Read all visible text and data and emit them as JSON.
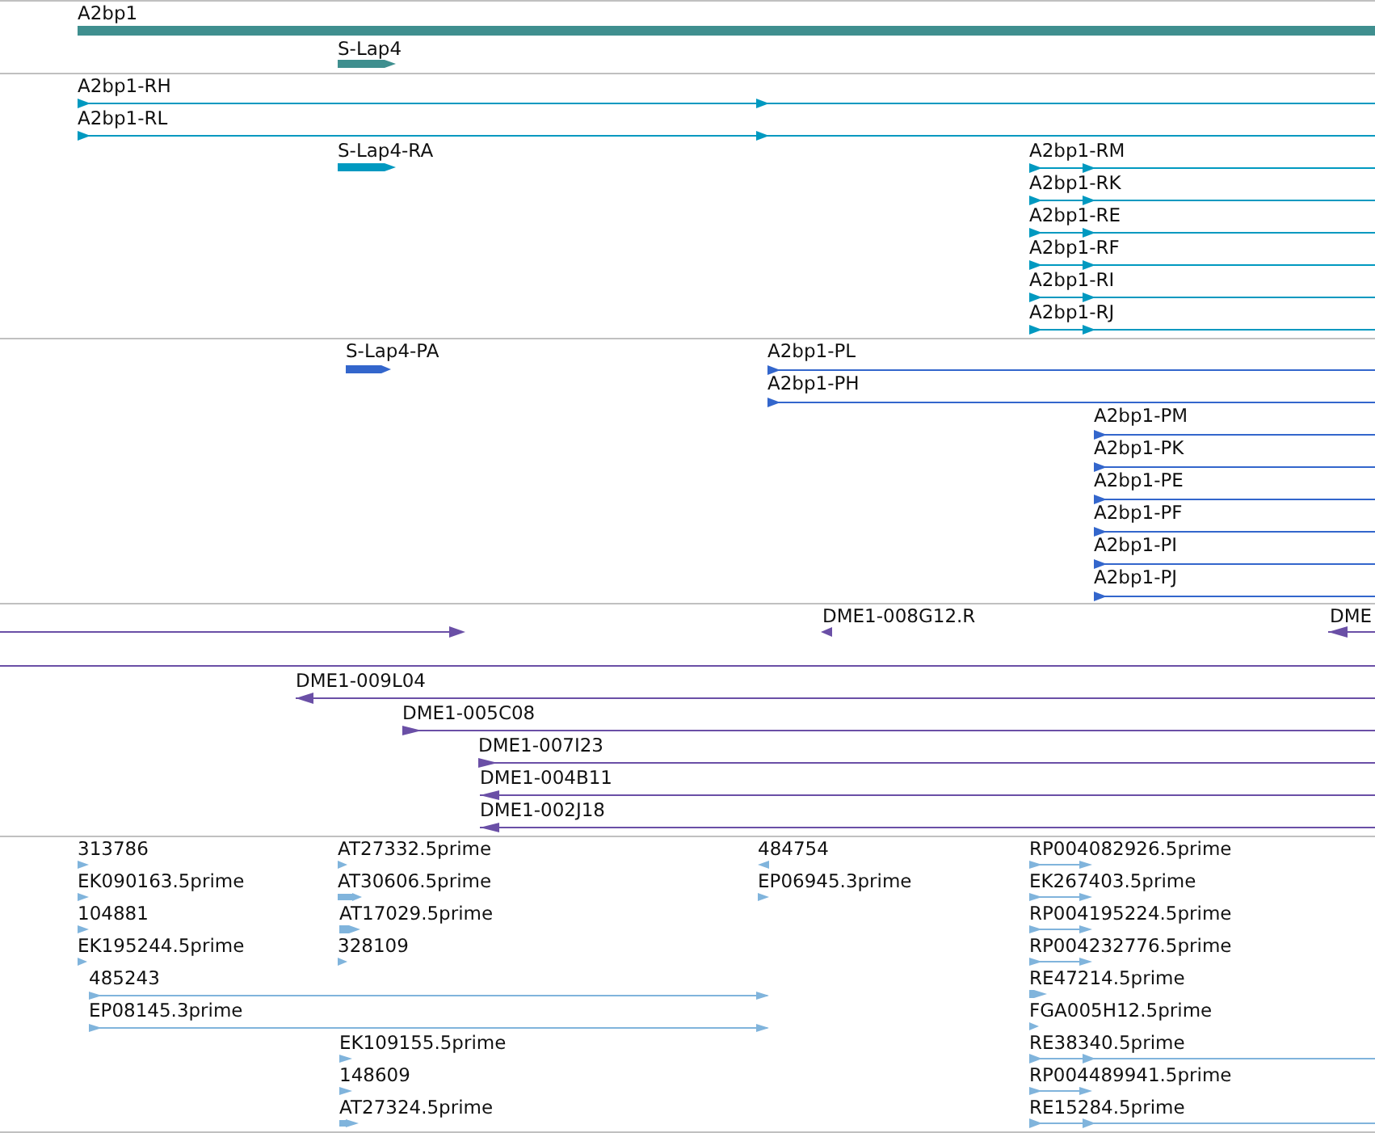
{
  "tracks": [
    {
      "color": "#3f8f8f",
      "features": [
        {
          "label": "A2bp1",
          "kind": "plain"
        },
        {
          "label": "S-Lap4",
          "kind": "arrow",
          "reverse": false
        }
      ]
    },
    {
      "color": "#0099c0",
      "features": [
        {
          "label": "A2bp1-RH",
          "kind": "arrow",
          "reverse": false
        },
        {
          "label": "A2bp1-RL",
          "kind": "arrow",
          "reverse": false
        },
        {
          "label": "S-Lap4-RA",
          "kind": "arrow",
          "reverse": false
        },
        {
          "label": "A2bp1-RM",
          "kind": "arrow",
          "reverse": false
        },
        {
          "label": "A2bp1-RK",
          "kind": "arrow",
          "reverse": false
        },
        {
          "label": "A2bp1-RE",
          "kind": "arrow",
          "reverse": false
        },
        {
          "label": "A2bp1-RF",
          "kind": "arrow",
          "reverse": false
        },
        {
          "label": "A2bp1-RI",
          "kind": "arrow",
          "reverse": false
        },
        {
          "label": "A2bp1-RJ",
          "kind": "arrow",
          "reverse": false
        }
      ]
    },
    {
      "color": "#3366cc",
      "features": [
        {
          "label": "S-Lap4-PA",
          "kind": "arrow",
          "reverse": false
        },
        {
          "label": "A2bp1-PL",
          "kind": "arrow",
          "reverse": false
        },
        {
          "label": "A2bp1-PH",
          "kind": "arrow",
          "reverse": false
        },
        {
          "label": "A2bp1-PM",
          "kind": "arrow",
          "reverse": false
        },
        {
          "label": "A2bp1-PK",
          "kind": "arrow",
          "reverse": false
        },
        {
          "label": "A2bp1-PE",
          "kind": "arrow",
          "reverse": false
        },
        {
          "label": "A2bp1-PF",
          "kind": "arrow",
          "reverse": false
        },
        {
          "label": "A2bp1-PI",
          "kind": "arrow",
          "reverse": false
        },
        {
          "label": "A2bp1-PJ",
          "kind": "arrow",
          "reverse": false
        }
      ]
    },
    {
      "color": "#6a4fa6",
      "features": [
        {
          "kind": "arrow",
          "reverse": false
        },
        {
          "label": "DME1-008G12.R",
          "kind": "arrow",
          "reverse": true
        },
        {
          "label": "DME",
          "kind": "arrow",
          "reverse": true
        },
        {
          "kind": "plain"
        },
        {
          "label": "DME1-009L04",
          "kind": "arrow",
          "reverse": true
        },
        {
          "label": "DME1-005C08",
          "kind": "arrow",
          "reverse": false
        },
        {
          "label": "DME1-007I23",
          "kind": "arrow",
          "reverse": false
        },
        {
          "label": "DME1-004B11",
          "kind": "arrow",
          "reverse": true
        },
        {
          "label": "DME1-002J18",
          "kind": "arrow",
          "reverse": true
        }
      ]
    },
    {
      "color": "#80b4dc",
      "features": [
        {
          "label": "313786",
          "kind": "arrow",
          "reverse": false
        },
        {
          "label": "EK090163.5prime",
          "kind": "arrow",
          "reverse": false
        },
        {
          "label": "104881",
          "kind": "arrow",
          "reverse": false
        },
        {
          "label": "EK195244.5prime",
          "kind": "arrow",
          "reverse": false
        },
        {
          "label": "485243",
          "kind": "arrow",
          "reverse": false
        },
        {
          "label": "EP08145.3prime",
          "kind": "arrow",
          "reverse": false
        },
        {
          "label": "AT27332.5prime",
          "kind": "arrow",
          "reverse": false
        },
        {
          "label": "AT30606.5prime",
          "kind": "arrow",
          "reverse": false
        },
        {
          "label": "AT17029.5prime",
          "kind": "arrow",
          "reverse": false
        },
        {
          "label": "328109",
          "kind": "arrow",
          "reverse": false
        },
        {
          "label": "EK109155.5prime",
          "kind": "arrow",
          "reverse": false
        },
        {
          "label": "148609",
          "kind": "arrow",
          "reverse": false
        },
        {
          "label": "AT27324.5prime",
          "kind": "arrow",
          "reverse": false
        },
        {
          "label": "484754",
          "kind": "arrow",
          "reverse": true
        },
        {
          "label": "EP06945.3prime",
          "kind": "arrow",
          "reverse": false
        },
        {
          "label": "RP004082926.5prime",
          "kind": "arrow",
          "reverse": false
        },
        {
          "label": "EK267403.5prime",
          "kind": "arrow",
          "reverse": false
        },
        {
          "label": "RP004195224.5prime",
          "kind": "arrow",
          "reverse": false
        },
        {
          "label": "RP004232776.5prime",
          "kind": "arrow",
          "reverse": false
        },
        {
          "label": "RE47214.5prime",
          "kind": "arrow",
          "reverse": false
        },
        {
          "label": "FGA005H12.5prime",
          "kind": "arrow",
          "reverse": false
        },
        {
          "label": "RE38340.5prime",
          "kind": "arrow",
          "reverse": false
        },
        {
          "label": "RP004489941.5prime",
          "kind": "arrow",
          "reverse": false
        },
        {
          "label": "RE15284.5prime",
          "kind": "arrow",
          "reverse": false
        }
      ]
    }
  ]
}
